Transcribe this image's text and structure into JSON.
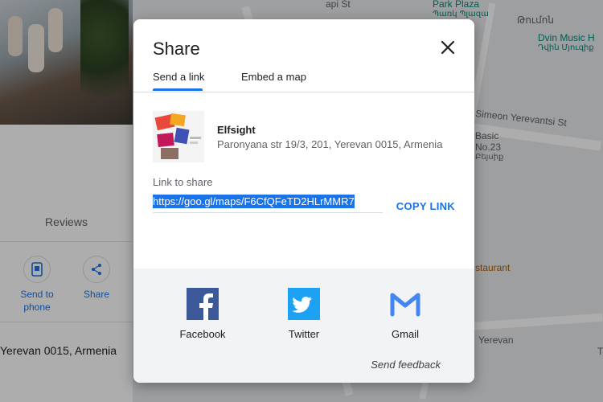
{
  "background": {
    "reviews_tab": "Reviews",
    "actions": [
      {
        "label_line1": "Send to",
        "label_line2": "phone",
        "icon": "phone-icon"
      },
      {
        "label_line1": "Share",
        "label_line2": "",
        "icon": "share-icon"
      }
    ],
    "address_partial": "Yerevan 0015, Armenia",
    "map_labels": {
      "park_plaza": "Park Plaza",
      "park_plaza_arm": "Պառկ Պլազա",
      "arm_top_right": "Թումոն",
      "dvin_music": "Dvin Music H",
      "dvin_music_arm": "Դվին Մյուզիք",
      "street_top": "api St",
      "simeon": "Simeon Yerevantsi St",
      "basic": "Basic",
      "basic_no": "No.23",
      "basic_arm": "Բեյսիք",
      "restaurant": "staurant",
      "yerevan": "Yerevan",
      "t_right": "T"
    }
  },
  "dialog": {
    "title": "Share",
    "close_icon": "close-icon",
    "tabs": [
      {
        "label": "Send a link",
        "active": true
      },
      {
        "label": "Embed a map",
        "active": false
      }
    ],
    "place": {
      "name": "Elfsight",
      "address": "Paronyana str 19/3, 201, Yerevan 0015, Armenia"
    },
    "link_label": "Link to share",
    "link_value": "https://goo.gl/maps/F6CfQFeTD2HLrMMR7",
    "copy_link": "COPY LINK",
    "share_targets": [
      {
        "label": "Facebook",
        "icon": "facebook-icon",
        "color": "#3b5998"
      },
      {
        "label": "Twitter",
        "icon": "twitter-icon",
        "color": "#1da1f2"
      },
      {
        "label": "Gmail",
        "icon": "gmail-icon",
        "color": "#4285f4"
      }
    ],
    "feedback": "Send feedback"
  }
}
